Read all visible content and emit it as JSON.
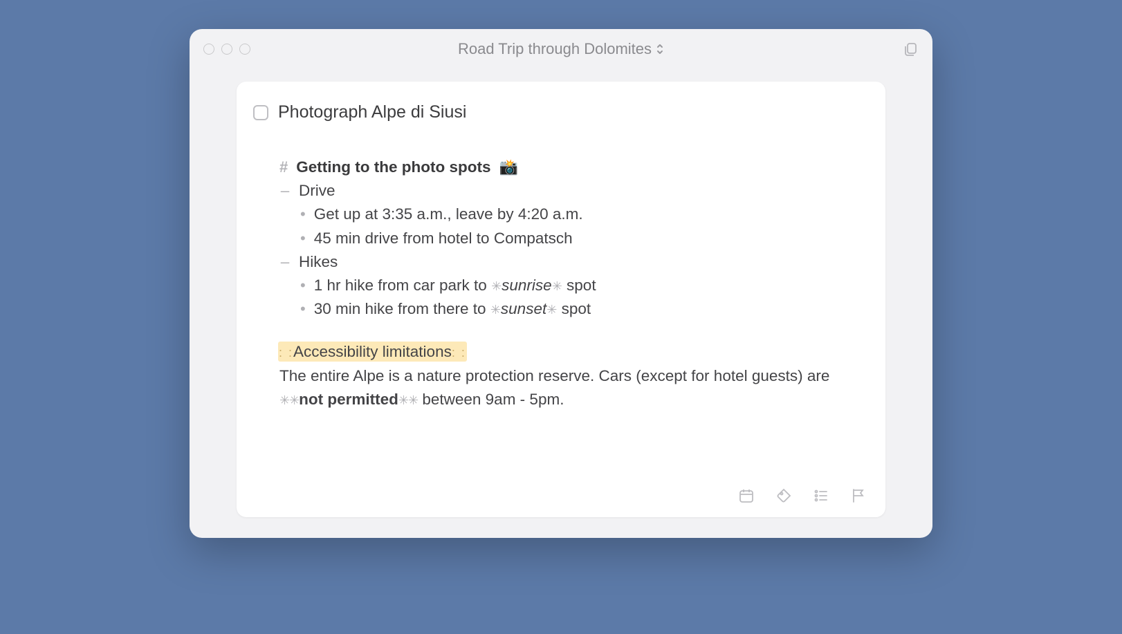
{
  "window": {
    "title": "Road Trip through Dolomites"
  },
  "task": {
    "title": "Photograph Alpe di Siusi",
    "checked": false
  },
  "note": {
    "heading_prefix": "#",
    "heading_text": "Getting to the photo spots",
    "heading_emoji": "📸",
    "section1": {
      "label": "Drive",
      "items": [
        "Get up at 3:35 a.m., leave by 4:20 a.m.",
        "45 min drive from hotel to Compatsch"
      ]
    },
    "section2": {
      "label": "Hikes",
      "items": [
        {
          "pre": "1 hr hike from car park to ",
          "it": "sunrise",
          "post": " spot"
        },
        {
          "pre": "30 min hike from there to ",
          "it": "sunset",
          "post": " spot"
        }
      ]
    },
    "highlight_label": "Accessibility limitations",
    "body_pre": "The entire Alpe is a nature protection reserve. Cars (except for hotel guests) are ",
    "body_bold": "not permitted",
    "body_post": " between 9am - 5pm."
  },
  "marks": {
    "dash": "–",
    "bullet": "•",
    "star": "✳︎",
    "dblstar": "✳︎✳︎",
    "hl": ": :"
  },
  "toolbar": {
    "calendar": "calendar-icon",
    "tag": "tag-icon",
    "list": "checklist-icon",
    "flag": "flag-icon"
  }
}
